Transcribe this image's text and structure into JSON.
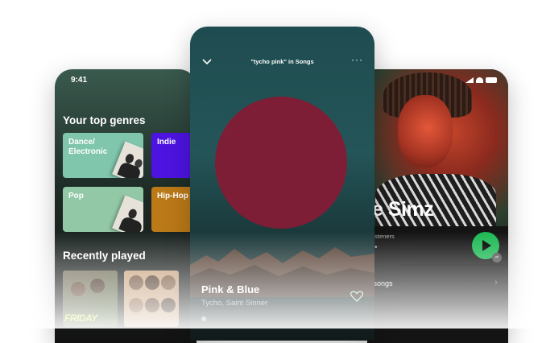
{
  "left_screen": {
    "time": "9:41",
    "genres_title": "Your top genres",
    "genres": [
      {
        "label": "Dance/ Electronic",
        "color": "#7fc6ac"
      },
      {
        "label": "Indie",
        "color": "#4d13e1"
      },
      {
        "label": "Pop",
        "color": "#93c8a6"
      },
      {
        "label": "Hip-Hop",
        "color": "#bb7918"
      }
    ],
    "recent_title": "Recently played",
    "albums": [
      {
        "badge_text": "FRIDAY"
      }
    ]
  },
  "center_screen": {
    "header_title": "\"tycho pink\" in Songs",
    "chevron_icon": "chevron-down-icon",
    "more_icon": "more-horizontal-icon",
    "art_color": "#7e1d36",
    "song_title": "Pink & Blue",
    "song_artist": "Tycho, Saint Sinner",
    "heart_icon": "heart-outline-icon"
  },
  "right_screen": {
    "artist_name": "e Simz",
    "listeners_text": "y listeners",
    "liked_songs_text": "d songs",
    "play_color": "#1db954"
  }
}
